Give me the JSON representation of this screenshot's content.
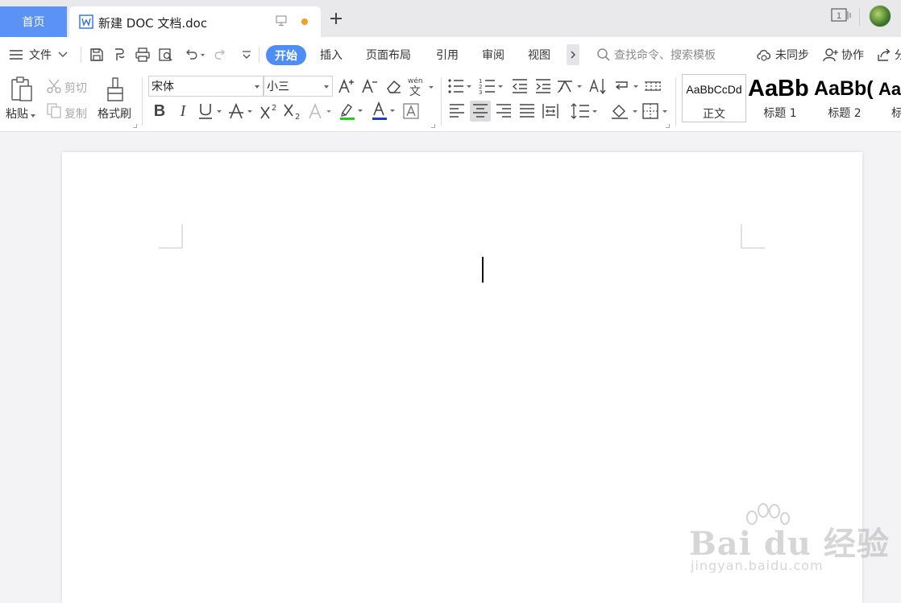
{
  "tabs": {
    "home": "首页",
    "doc_title": "新建 DOC 文档.doc"
  },
  "menu": {
    "file": "文件",
    "tabs": [
      "开始",
      "插入",
      "页面布局",
      "引用",
      "审阅",
      "视图"
    ],
    "search_placeholder": "查找命令、搜索模板",
    "sync": "未同步",
    "collab": "协作",
    "share": "分"
  },
  "ribbon": {
    "paste": "粘贴",
    "cut": "剪切",
    "copy": "复制",
    "format_painter": "格式刷",
    "font_name": "宋体",
    "font_size": "小三",
    "pinyin": "wén"
  },
  "styles": [
    {
      "sample": "AaBbCcDd",
      "name": "正文"
    },
    {
      "sample": "AaBb",
      "name": "标题 1"
    },
    {
      "sample": "AaBb(",
      "name": "标题 2"
    },
    {
      "sample": "Aa",
      "name": "标"
    }
  ],
  "watermark": {
    "brand": "Bai du 经验",
    "url": "jingyan.baidu.com"
  },
  "colors": {
    "accent": "#4d8df5",
    "home_tab": "#5b92f5",
    "highlight": "#22cc22",
    "font_color": "#1a3cc8"
  }
}
